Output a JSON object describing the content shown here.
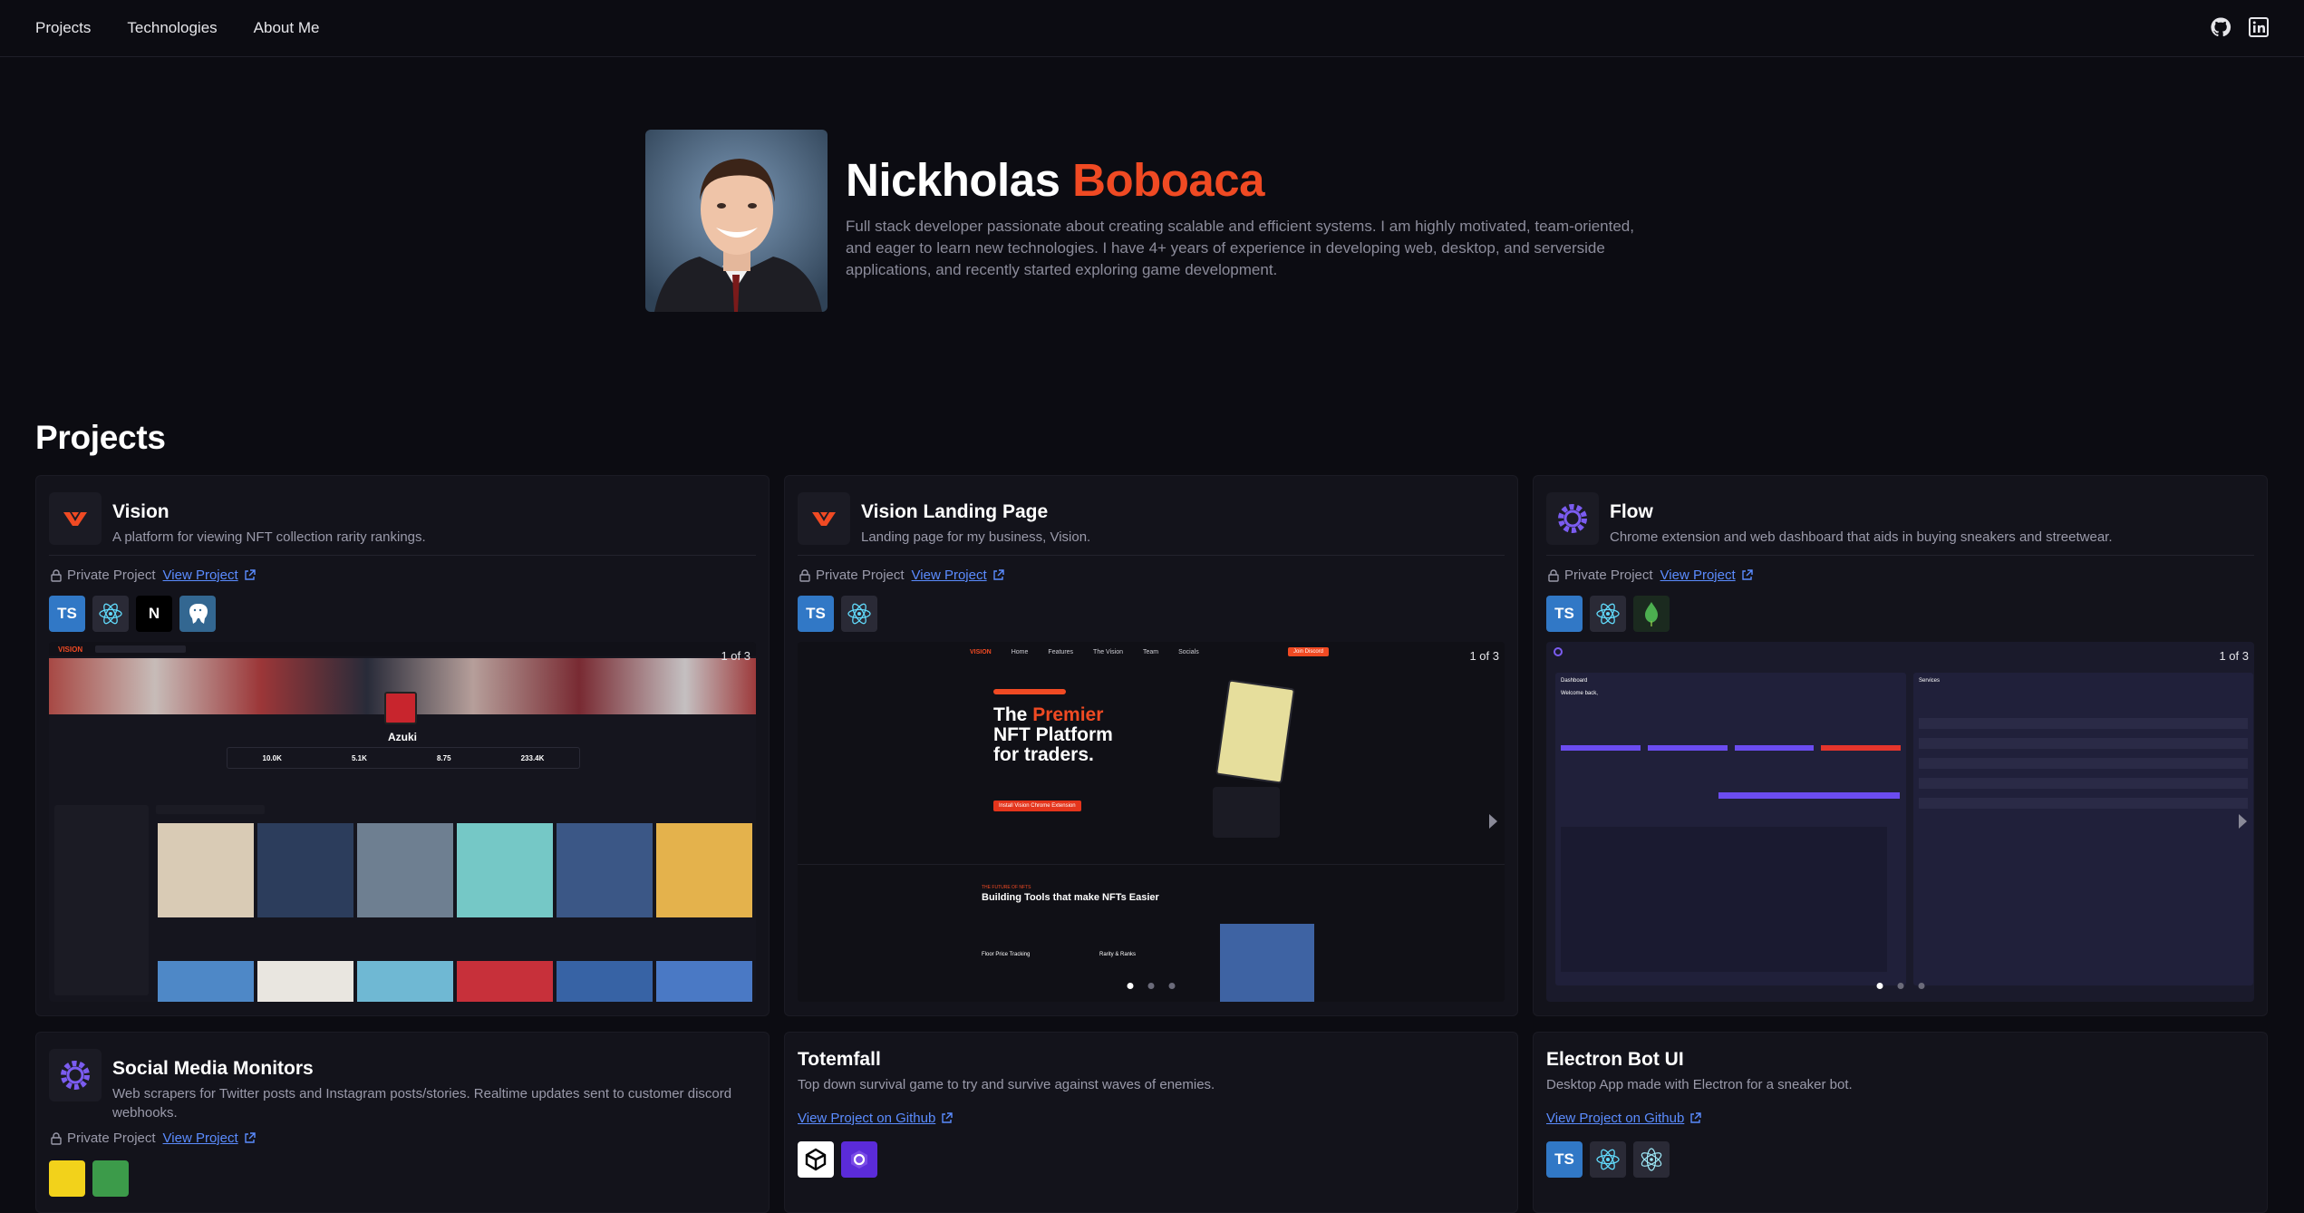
{
  "nav": {
    "links": [
      "Projects",
      "Technologies",
      "About Me"
    ],
    "icons": [
      "github-icon",
      "linkedin-icon"
    ]
  },
  "hero": {
    "first_name": "Nickholas",
    "last_name": "Boboaca",
    "bio": "Full stack developer passionate about creating scalable and efficient systems. I am highly motivated, team-oriented, and eager to learn new technologies. I have 4+ years of experience in developing web, desktop, and serverside applications, and recently started exploring game development.",
    "accent_color": "#f04a23"
  },
  "projects_title": "Projects",
  "projects": [
    {
      "title": "Vision",
      "description": "A platform for viewing NFT collection rarity rankings.",
      "private_label": "Private Project",
      "link_label": "View Project",
      "techs": [
        "TS",
        "react",
        "N",
        "postgres"
      ],
      "counter": "1 of 3",
      "shot": {
        "brand": "VISION",
        "collection": "Azuki",
        "stats": [
          "10.0K",
          "5.1K",
          "8.75",
          "233.4K"
        ]
      }
    },
    {
      "title": "Vision Landing Page",
      "description": "Landing page for my business, Vision.",
      "private_label": "Private Project",
      "link_label": "View Project",
      "techs": [
        "TS",
        "react"
      ],
      "counter": "1 of 3",
      "shot": {
        "brand": "VISION",
        "menu": [
          "Home",
          "Features",
          "The Vision",
          "Team",
          "Socials"
        ],
        "cta": "Join Discord",
        "headline_1": "The",
        "headline_accent": "Premier",
        "headline_2": "NFT Platform",
        "headline_3": "for traders.",
        "install": "Install Vision Chrome Extension",
        "section_label": "THE FUTURE OF NFTS",
        "section_title": "Building Tools that make NFTs Easier",
        "feature_1": "Floor Price Tracking",
        "feature_2": "Rarity & Ranks"
      }
    },
    {
      "title": "Flow",
      "description": "Chrome extension and web dashboard that aids in buying sneakers and streetwear.",
      "private_label": "Private Project",
      "link_label": "View Project",
      "techs": [
        "TS",
        "react",
        "mongodb"
      ],
      "counter": "1 of 3",
      "shot": {
        "left_title": "Dashboard",
        "left_sub": "Welcome back,",
        "right_title": "Services"
      }
    },
    {
      "title": "Social Media Monitors",
      "description": "Web scrapers for Twitter posts and Instagram posts/stories. Realtime updates sent to customer discord webhooks.",
      "private_label": "Private Project",
      "link_label": "View Project"
    },
    {
      "title": "Totemfall",
      "description": "Top down survival game to try and survive against waves of enemies.",
      "link_label": "View Project on Github"
    },
    {
      "title": "Electron Bot UI",
      "description": "Desktop App made with Electron for a sneaker bot.",
      "link_label": "View Project on Github"
    }
  ]
}
